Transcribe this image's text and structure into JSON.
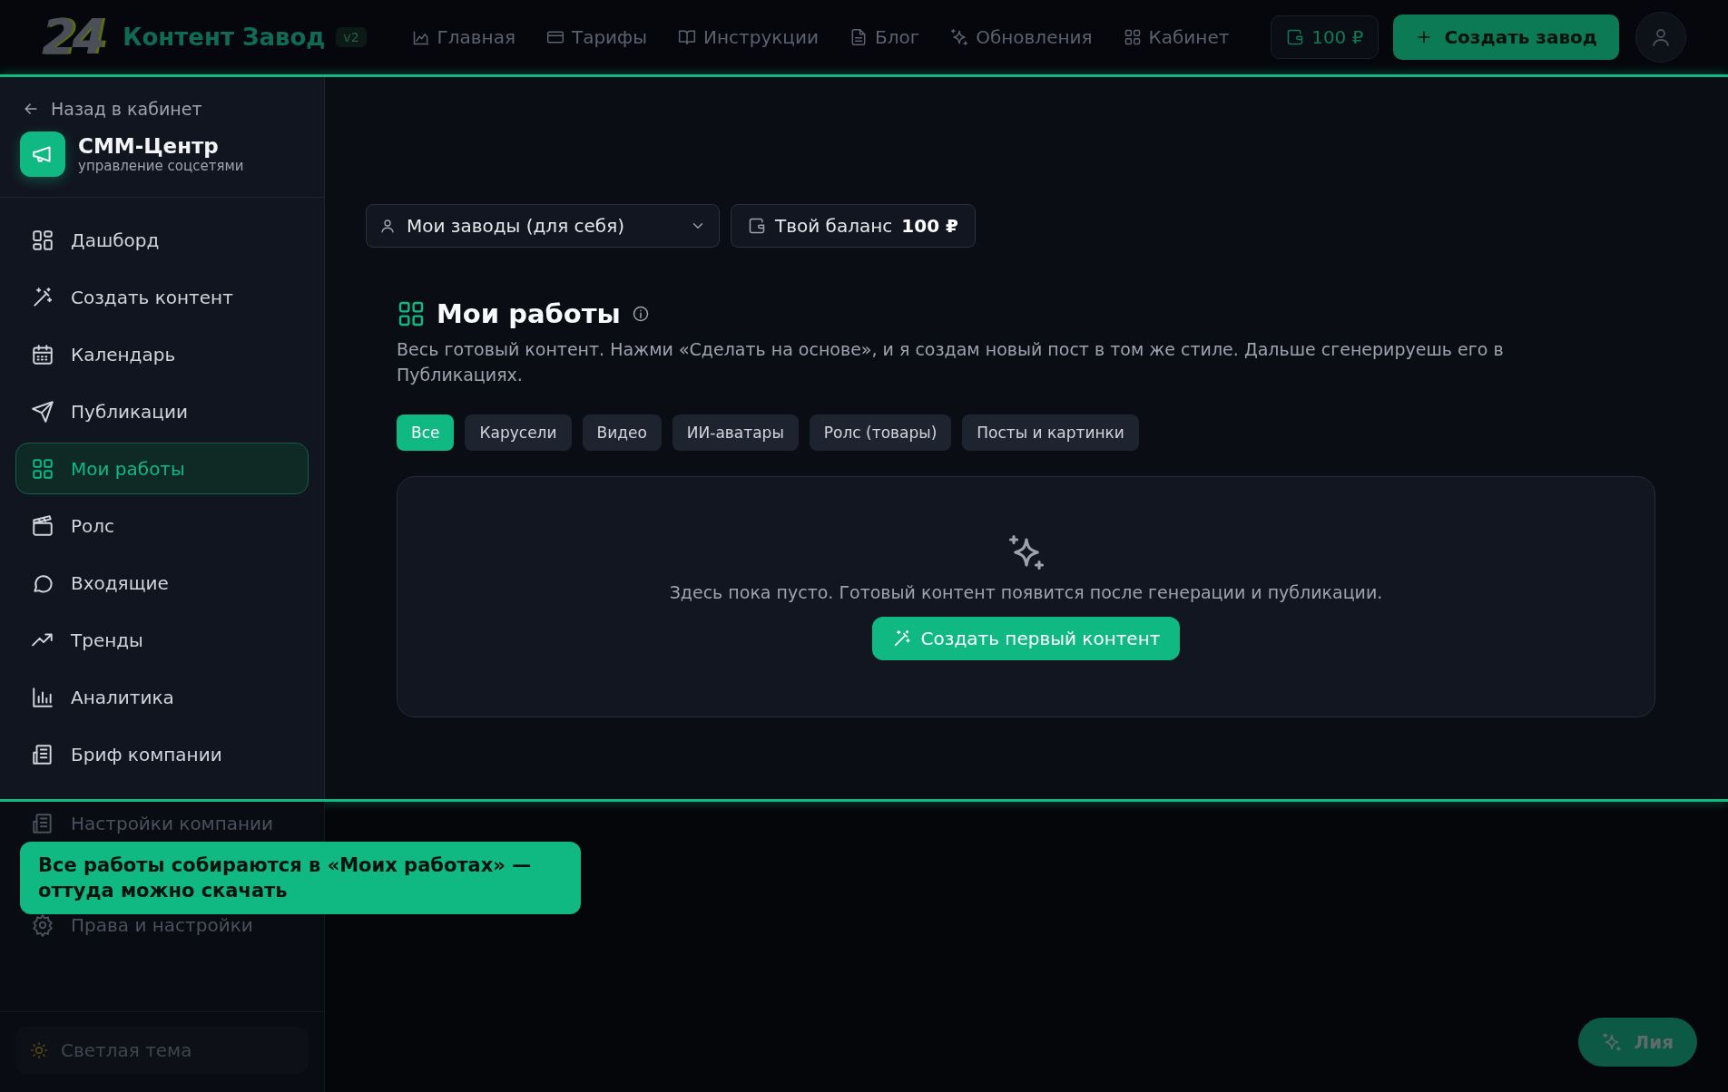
{
  "header": {
    "logo": "24",
    "brand": "Контент Завод",
    "version": "v2",
    "nav": [
      {
        "label": "Главная"
      },
      {
        "label": "Тарифы"
      },
      {
        "label": "Инструкции"
      },
      {
        "label": "Блог"
      },
      {
        "label": "Обновления"
      },
      {
        "label": "Кабинет"
      }
    ],
    "balance": "100 ₽",
    "create_button": "Создать завод"
  },
  "sidebar": {
    "back": "Назад в кабинет",
    "app": {
      "name": "СММ-Центр",
      "subtitle": "управление соцсетями"
    },
    "items": [
      {
        "label": "Дашборд",
        "selected": false
      },
      {
        "label": "Создать контент",
        "selected": false
      },
      {
        "label": "Календарь",
        "selected": false
      },
      {
        "label": "Публикации",
        "selected": false
      },
      {
        "label": "Мои работы",
        "selected": true
      },
      {
        "label": "Ролс",
        "selected": false
      },
      {
        "label": "Входящие",
        "selected": false
      },
      {
        "label": "Тренды",
        "selected": false
      },
      {
        "label": "Аналитика",
        "selected": false
      },
      {
        "label": "Бриф компании",
        "selected": false
      }
    ],
    "dimmed_items": [
      {
        "label": "Настройки компании"
      },
      {
        "label": "Права и настройки"
      }
    ],
    "theme_toggle": "Светлая тема"
  },
  "main": {
    "factory_select": "Мои заводы (для себя)",
    "balance": {
      "label": "Твой баланс",
      "amount": "100 ₽"
    },
    "title": "Мои работы",
    "description": "Весь готовый контент. Нажми «Сделать на основе», и я создам новый пост в том же стиле. Дальше сгенерируешь его в Публикациях.",
    "filters": [
      {
        "label": "Все",
        "selected": true
      },
      {
        "label": "Карусели",
        "selected": false
      },
      {
        "label": "Видео",
        "selected": false
      },
      {
        "label": "ИИ-аватары",
        "selected": false
      },
      {
        "label": "Ролс (товары)",
        "selected": false
      },
      {
        "label": "Посты и картинки",
        "selected": false
      }
    ],
    "empty": {
      "message": "Здесь пока пусто. Готовый контент появится после генерации и публикации.",
      "button": "Создать первый контент"
    }
  },
  "tour": {
    "message": "Все работы собираются в «Моих работах» — оттуда можно скачать"
  },
  "assistant": {
    "label": "Лия"
  }
}
